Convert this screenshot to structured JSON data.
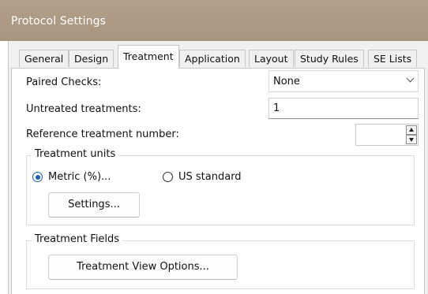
{
  "window": {
    "title": "Protocol Settings"
  },
  "tabs": [
    {
      "label": "General",
      "active": false
    },
    {
      "label": "Design",
      "active": false
    },
    {
      "label": "Treatment",
      "active": true
    },
    {
      "label": "Application",
      "active": false
    },
    {
      "label": "Layout",
      "active": false
    },
    {
      "label": "Study Rules",
      "active": false
    },
    {
      "label": "SE Lists",
      "active": false
    }
  ],
  "fields": {
    "paired_checks": {
      "label": "Paired Checks:",
      "value": "None"
    },
    "untreated_treatments": {
      "label": "Untreated treatments:",
      "value": "1"
    },
    "reference_treatment_number": {
      "label": "Reference treatment number:",
      "value": ""
    }
  },
  "treatment_units": {
    "legend": "Treatment units",
    "options": [
      {
        "label": "Metric (%)...",
        "checked": true
      },
      {
        "label": "US standard",
        "checked": false
      }
    ],
    "settings_button": "Settings..."
  },
  "treatment_fields": {
    "legend": "Treatment Fields",
    "view_options_button": "Treatment View Options..."
  },
  "colors": {
    "titlebar": "#b3a08a",
    "radio_accent": "#1a5fb4"
  }
}
